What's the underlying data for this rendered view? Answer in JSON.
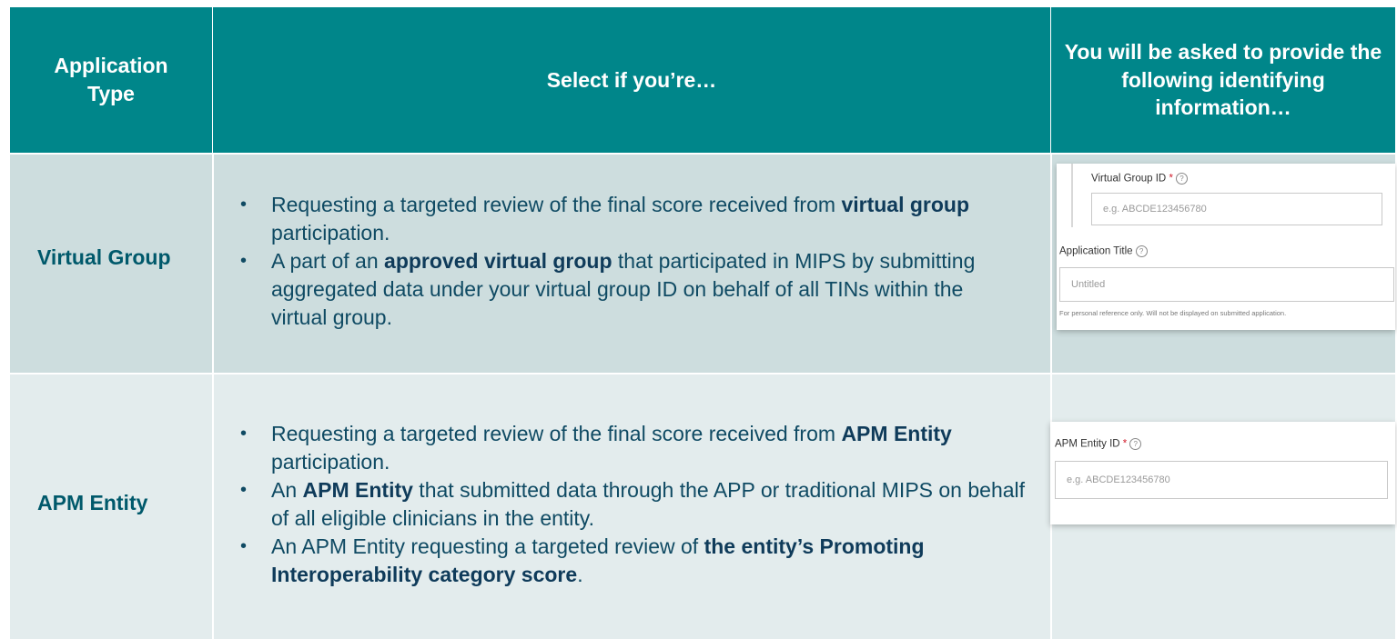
{
  "header": {
    "col_type": "Application Type",
    "col_select": "Select if you’re…",
    "col_info": "You will be asked to provide the following identifying information…"
  },
  "rows": [
    {
      "type": "Virtual Group",
      "b1_pre": "Requesting a targeted review of the final score received from ",
      "b1_bold": "virtual group",
      "b1_post": " participation.",
      "b2_pre": "A part of an ",
      "b2_bold": "approved virtual group",
      "b2_post": " that participated in MIPS by submitting aggregated data under your virtual group ID on behalf of all TINs within the virtual group.",
      "form": {
        "field1_label": "Virtual Group ID",
        "field1_placeholder": "e.g. ABCDE123456780",
        "field2_label": "Application Title",
        "field2_placeholder": "Untitled",
        "hint": "For personal reference only. Will not be displayed on submitted application."
      }
    },
    {
      "type": "APM Entity",
      "b1_pre": "Requesting a targeted review of the final score received from ",
      "b1_bold": "APM Entity",
      "b1_post": " participation.",
      "b2_pre": "An ",
      "b2_bold": "APM Entity",
      "b2_post": " that submitted data through the APP or traditional MIPS on behalf of all eligible clinicians in the entity.",
      "b3_pre": "An APM Entity requesting a targeted review of ",
      "b3_bold": "the entity’s Promoting Interoperability category score",
      "b3_post": ".",
      "form": {
        "field1_label": "APM Entity ID",
        "field1_placeholder": "e.g. ABCDE123456780"
      }
    }
  ],
  "colors": {
    "header": "#00868a",
    "row1": "#cdddde",
    "row2": "#e3eced",
    "type_text": "#00596b",
    "body_text": "#0f4a63"
  },
  "icons": {
    "help": "question-circle-icon",
    "bullet": "bullet-icon"
  }
}
